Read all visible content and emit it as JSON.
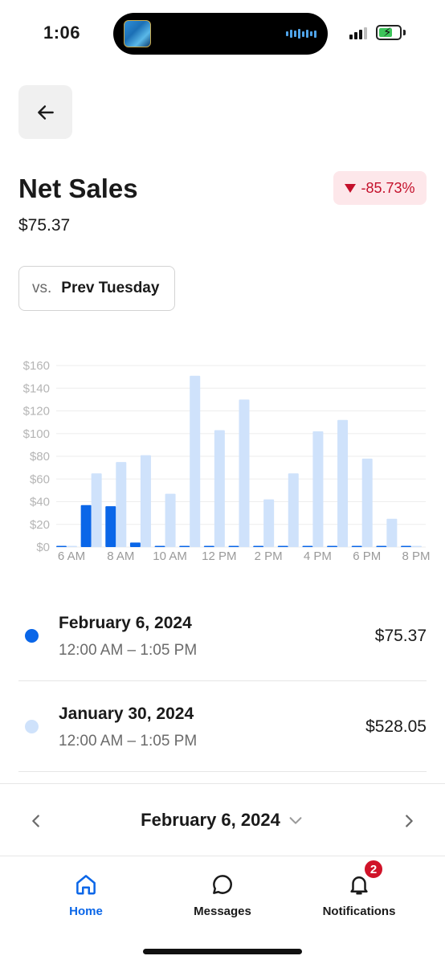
{
  "status_bar": {
    "time": "1:06",
    "battery_charging": true
  },
  "header": {
    "back_icon": "arrow-left-icon",
    "title": "Net Sales",
    "amount": "$75.37",
    "change": "-85.73%",
    "change_color": "#c4102b",
    "change_bg": "#fde7ea"
  },
  "compare": {
    "prefix": "vs.",
    "value": "Prev Tuesday"
  },
  "chart_data": {
    "type": "bar",
    "title": "",
    "xlabel": "",
    "ylabel": "",
    "ylim": [
      0,
      160
    ],
    "yticks": [
      "$160",
      "$140",
      "$120",
      "$100",
      "$80",
      "$60",
      "$40",
      "$20",
      "$0"
    ],
    "xticks": [
      "6 AM",
      "8 AM",
      "10 AM",
      "12 PM",
      "2 PM",
      "4 PM",
      "6 PM",
      "8 PM"
    ],
    "grid": true,
    "legend": "none",
    "categories": [
      "6 AM",
      "7 AM",
      "8 AM",
      "9 AM",
      "10 AM",
      "11 AM",
      "12 PM",
      "1 PM",
      "2 PM",
      "3 PM",
      "4 PM",
      "5 PM",
      "6 PM",
      "7 PM",
      "8 PM"
    ],
    "series": [
      {
        "name": "February 6, 2024",
        "color": "#0a66e8",
        "values": [
          0,
          37,
          36,
          4,
          0,
          0,
          0,
          0,
          0,
          0,
          0,
          0,
          0,
          0,
          0
        ]
      },
      {
        "name": "January 30, 2024",
        "color": "#cfe2fb",
        "values": [
          0,
          65,
          75,
          81,
          47,
          151,
          103,
          130,
          42,
          65,
          102,
          112,
          78,
          25,
          0
        ]
      }
    ]
  },
  "legend": [
    {
      "date": "February 6, 2024",
      "range": "12:00 AM – 1:05 PM",
      "value": "$75.37",
      "color": "#0a66e8"
    },
    {
      "date": "January 30, 2024",
      "range": "12:00 AM – 1:05 PM",
      "value": "$528.05",
      "color": "#cfe2fb"
    }
  ],
  "date_nav": {
    "label": "February 6, 2024",
    "prev_icon": "chevron-left-icon",
    "next_icon": "chevron-right-icon",
    "dropdown_icon": "chevron-down-icon"
  },
  "tabs": [
    {
      "label": "Home",
      "icon": "home-icon",
      "active": true,
      "color": "#0a66e8"
    },
    {
      "label": "Messages",
      "icon": "chat-bubble-icon",
      "active": false,
      "color": "#1a1a1a"
    },
    {
      "label": "Notifications",
      "icon": "bell-icon",
      "active": false,
      "color": "#1a1a1a",
      "badge": "2"
    }
  ]
}
